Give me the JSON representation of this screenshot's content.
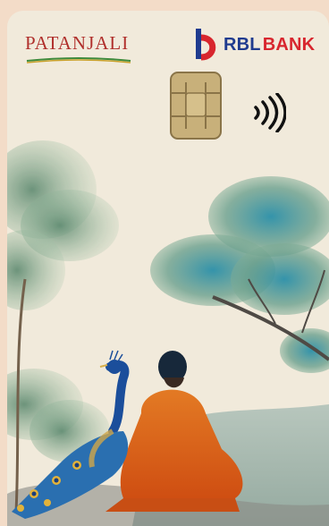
{
  "card": {
    "issuer_brand": "PATANJALI",
    "bank_name_part1": "RBL",
    "bank_name_part2": "BANK"
  },
  "icons": {
    "contactless": "contactless-payment-icon",
    "chip": "emv-chip-icon",
    "bank_logo": "rbl-bank-logo-icon"
  },
  "colors": {
    "card_background": "#f1eadb",
    "page_background": "#f3dcc8",
    "brand_red": "#b0302c",
    "bank_blue": "#1f3b8f",
    "bank_red": "#d8262e",
    "robe_orange": "#e06a1b",
    "peacock_blue": "#1f4f9a",
    "tree_teal": "#4f8f8a"
  }
}
